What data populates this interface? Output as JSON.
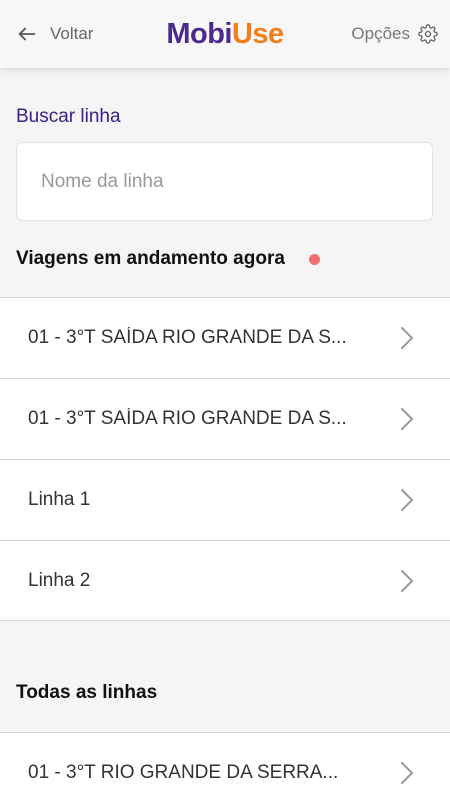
{
  "header": {
    "back_label": "Voltar",
    "logo_part1": "Mobi",
    "logo_part2": "Use",
    "options_label": "Opções"
  },
  "search": {
    "label": "Buscar linha",
    "placeholder": "Nome da linha",
    "value": ""
  },
  "ongoing": {
    "title": "Viagens em andamento agora",
    "items": [
      {
        "label": "01 - 3°T SAÍDA RIO GRANDE DA S..."
      },
      {
        "label": "01 - 3°T SAÍDA RIO GRANDE DA S..."
      },
      {
        "label": "Linha 1"
      },
      {
        "label": "Linha 2"
      }
    ]
  },
  "all_lines": {
    "title": "Todas as linhas",
    "items": [
      {
        "label": "01 - 3°T RIO GRANDE DA SERRA..."
      }
    ]
  },
  "colors": {
    "brand_purple": "#4b2a8c",
    "brand_orange": "#f07f1c",
    "live_dot": "#f07070"
  }
}
